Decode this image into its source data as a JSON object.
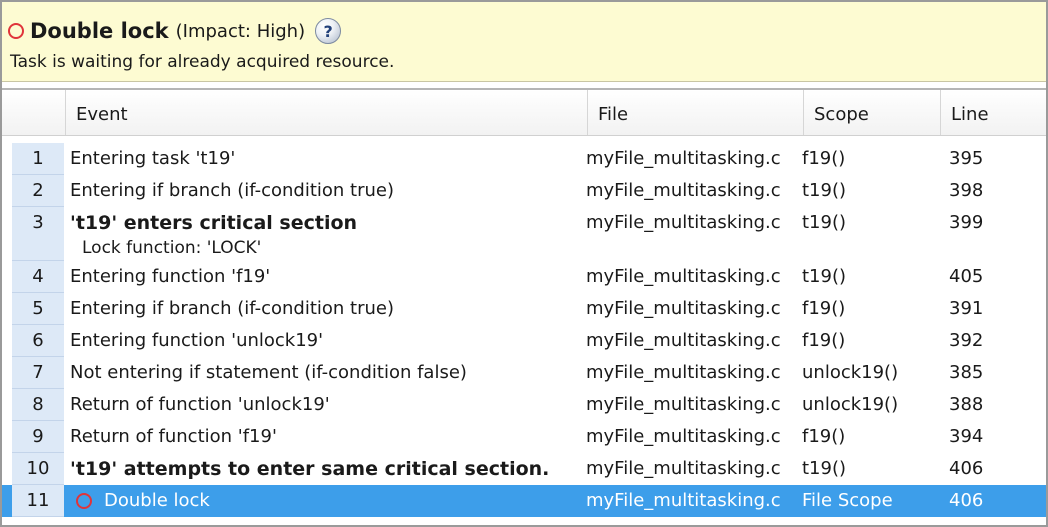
{
  "header": {
    "title": "Double lock",
    "impact": "(Impact: High)",
    "help_symbol": "?",
    "description": "Task is waiting for already acquired resource."
  },
  "columns": {
    "num": "",
    "event": "Event",
    "file": "File",
    "scope": "Scope",
    "line": "Line"
  },
  "rows": [
    {
      "num": "1",
      "event": "Entering task 't19'",
      "file": "myFile_multitasking.c",
      "scope": "f19()",
      "line": "395"
    },
    {
      "num": "2",
      "event": "Entering if branch (if-condition true)",
      "file": "myFile_multitasking.c",
      "scope": "t19()",
      "line": "398"
    },
    {
      "num": "3",
      "event": "'t19' enters critical section",
      "detail": "Lock function: 'LOCK'",
      "file": "myFile_multitasking.c",
      "scope": "t19()",
      "line": "399"
    },
    {
      "num": "4",
      "event": "Entering function 'f19'",
      "file": "myFile_multitasking.c",
      "scope": "t19()",
      "line": "405"
    },
    {
      "num": "5",
      "event": "Entering if branch (if-condition true)",
      "file": "myFile_multitasking.c",
      "scope": "f19()",
      "line": "391"
    },
    {
      "num": "6",
      "event": "Entering function 'unlock19'",
      "file": "myFile_multitasking.c",
      "scope": "f19()",
      "line": "392"
    },
    {
      "num": "7",
      "event": "Not entering if statement (if-condition false)",
      "file": "myFile_multitasking.c",
      "scope": "unlock19()",
      "line": "385"
    },
    {
      "num": "8",
      "event": "Return of function 'unlock19'",
      "file": "myFile_multitasking.c",
      "scope": "unlock19()",
      "line": "388"
    },
    {
      "num": "9",
      "event": "Return of function 'f19'",
      "file": "myFile_multitasking.c",
      "scope": "f19()",
      "line": "394"
    },
    {
      "num": "10",
      "event": "'t19' attempts to enter same critical section.",
      "file": "myFile_multitasking.c",
      "scope": "t19()",
      "line": "406"
    },
    {
      "num": "11",
      "event": "Double lock",
      "file": "myFile_multitasking.c",
      "scope": "File Scope",
      "line": "406"
    }
  ],
  "colors": {
    "header_bg": "#fdfbd2",
    "selection": "#3d9eea",
    "row_number_bg": "#dde9f7",
    "defect_ring": "#e0343a"
  },
  "icons": {
    "defect": "red-ring-icon",
    "help": "help-icon"
  }
}
